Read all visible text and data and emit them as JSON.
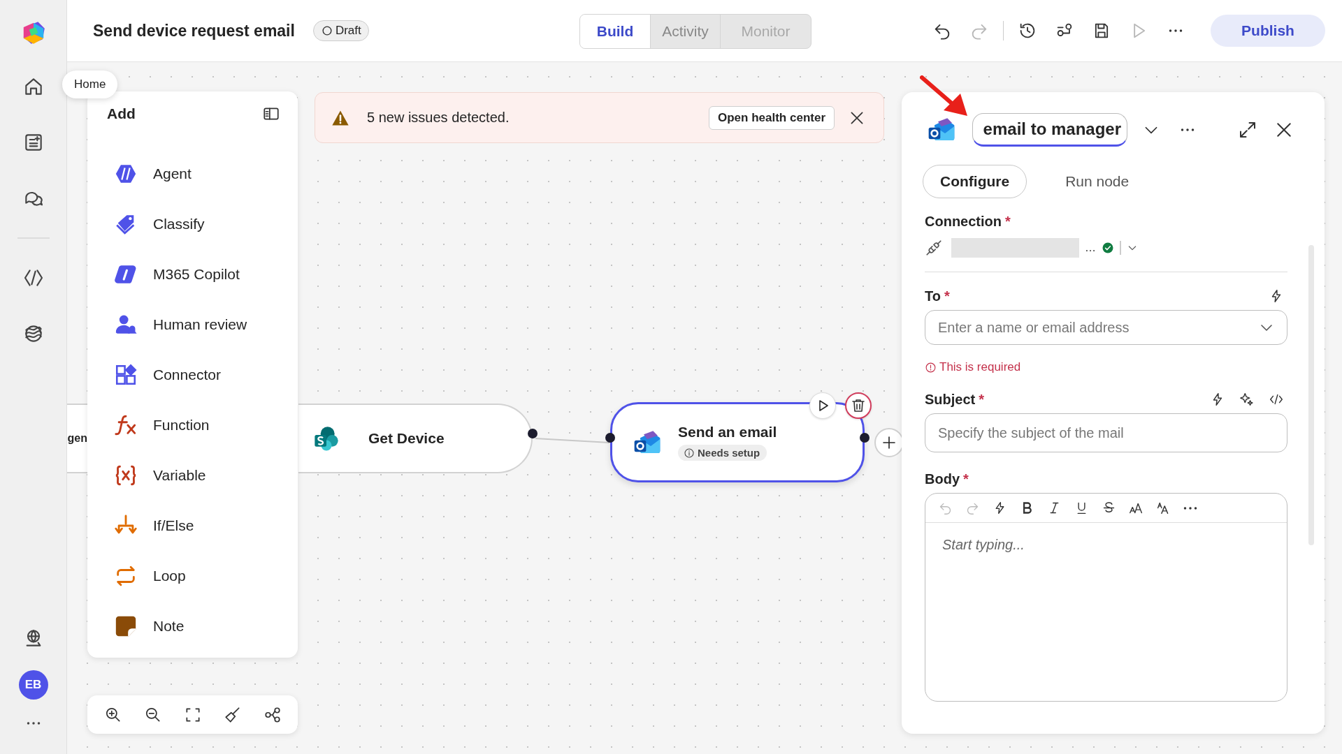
{
  "tooltip": "Home",
  "rail": {
    "avatar": "EB"
  },
  "header": {
    "title": "Send device request email",
    "status": "Draft",
    "tabs": [
      {
        "label": "Build",
        "selected": true,
        "disabled": false
      },
      {
        "label": "Activity",
        "selected": false,
        "disabled": false
      },
      {
        "label": "Monitor",
        "selected": false,
        "disabled": true
      }
    ],
    "tools": [
      {
        "kind": "undo",
        "disabled": false
      },
      {
        "kind": "redo",
        "disabled": true
      },
      {
        "kind": "history",
        "disabled": false
      },
      {
        "kind": "share",
        "disabled": false
      },
      {
        "kind": "save",
        "disabled": false
      },
      {
        "kind": "run",
        "disabled": true
      },
      {
        "kind": "more",
        "disabled": false
      }
    ],
    "publish": "Publish"
  },
  "add_panel": {
    "title": "Add",
    "items": [
      {
        "label": "Agent",
        "kind": "agent"
      },
      {
        "label": "Classify",
        "kind": "classify"
      },
      {
        "label": "M365 Copilot",
        "kind": "copilot"
      },
      {
        "label": "Human review",
        "kind": "human"
      },
      {
        "label": "Connector",
        "kind": "connector"
      },
      {
        "label": "Function",
        "kind": "function"
      },
      {
        "label": "Variable",
        "kind": "variable"
      },
      {
        "label": "If/Else",
        "kind": "ifelse"
      },
      {
        "label": "Loop",
        "kind": "loop"
      },
      {
        "label": "Note",
        "kind": "note"
      }
    ]
  },
  "banner": {
    "message": "5 new issues detected.",
    "action": "Open health center"
  },
  "canvas": {
    "nodes": [
      {
        "label": "gen",
        "kind": "partial",
        "selected": false
      },
      {
        "label": "Get Device",
        "kind": "sharepoint",
        "selected": false
      },
      {
        "label": "Send an email",
        "kind": "outlook",
        "selected": true,
        "badge": "Needs setup"
      }
    ]
  },
  "node_panel": {
    "name": "email to manager",
    "tabs": [
      {
        "label": "Configure",
        "selected": true
      },
      {
        "label": "Run node",
        "selected": false
      }
    ],
    "connection": {
      "label": "Connection",
      "marker": "*",
      "more": "…",
      "connected": true
    },
    "fields": [
      {
        "label": "To",
        "marker": "*",
        "kind": "dropdown",
        "placeholder": "Enter a name or email address",
        "error": "This is required"
      },
      {
        "label": "Subject",
        "marker": "*",
        "kind": "text",
        "placeholder": "Specify the subject of the mail"
      },
      {
        "label": "Body",
        "marker": "*",
        "kind": "richtext",
        "placeholder": "Start typing..."
      }
    ]
  }
}
